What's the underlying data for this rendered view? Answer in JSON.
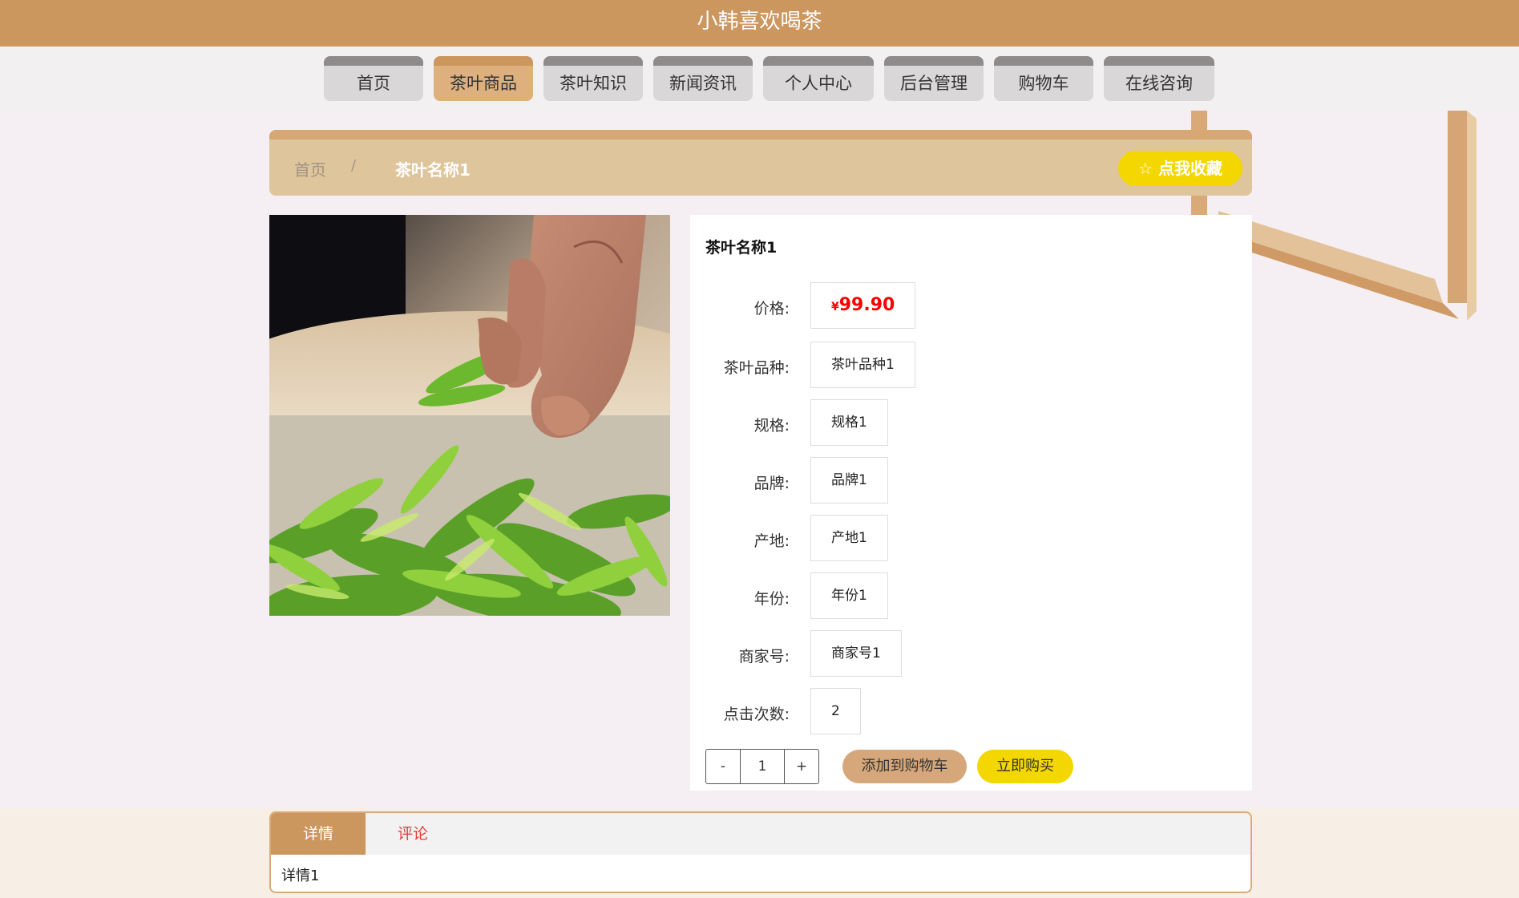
{
  "site": {
    "title": "小韩喜欢喝茶"
  },
  "nav": {
    "items": [
      "首页",
      "茶叶商品",
      "茶叶知识",
      "新闻资讯",
      "个人中心",
      "后台管理",
      "购物车",
      "在线咨询"
    ],
    "active_index": 1
  },
  "breadcrumb": {
    "home": "首页",
    "separator": "/",
    "current": "茶叶名称1"
  },
  "favorite_button": {
    "icon": "star-outline-icon",
    "label": "点我收藏"
  },
  "product": {
    "name": "茶叶名称1",
    "price_symbol": "¥",
    "price": "99.90",
    "fields": {
      "price_label": "价格:",
      "variety_label": "茶叶品种:",
      "variety": "茶叶品种1",
      "spec_label": "规格:",
      "spec": "规格1",
      "brand_label": "品牌:",
      "brand": "品牌1",
      "origin_label": "产地:",
      "origin": "产地1",
      "year_label": "年份:",
      "year": "年份1",
      "merchant_label": "商家号:",
      "merchant": "商家号1",
      "clicks_label": "点击次数:",
      "clicks": "2"
    }
  },
  "quantity": {
    "minus": "-",
    "value": "1",
    "plus": "+"
  },
  "actions": {
    "add_to_cart": "添加到购物车",
    "buy_now": "立即购买"
  },
  "tabs": {
    "detail": "详情",
    "comment": "评论",
    "content": "详情1"
  },
  "colors": {
    "brand": "#cc965f",
    "accent_yellow": "#f4d600",
    "price_red": "#ff0000"
  }
}
